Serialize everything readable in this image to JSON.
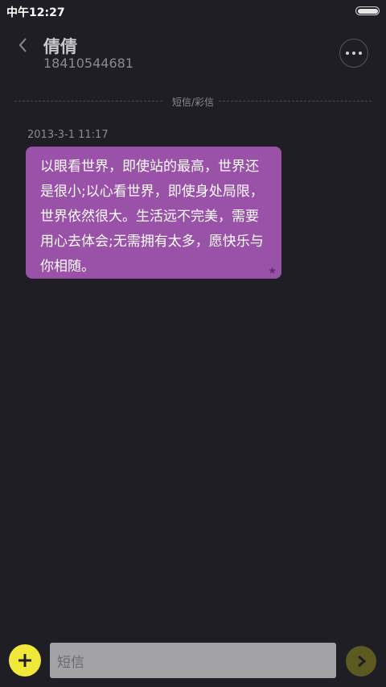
{
  "status_bar": {
    "time": "中午12:27",
    "battery_level": 1.0
  },
  "header": {
    "contact_name": "倩倩",
    "contact_number": "18410544681",
    "back_icon": "chevron-left-icon",
    "more_icon": "more-dots-icon"
  },
  "divider": {
    "label": "短信/彩信"
  },
  "messages": [
    {
      "timestamp": "2013-3-1 11:17",
      "text": "以眼看世界，即使站的最高，世界还是很小;以心看世界，即使身处局限，世界依然很大。生活远不完美，需要用心去体会;无需拥有太多，愿快乐与你相随。",
      "starred": true,
      "bubble_color": "#9a52a8"
    }
  ],
  "compose": {
    "placeholder": "短信",
    "add_icon": "plus-icon",
    "send_icon": "send-arrow-icon",
    "add_color": "#f2e83a",
    "send_color": "#5d5a21"
  }
}
